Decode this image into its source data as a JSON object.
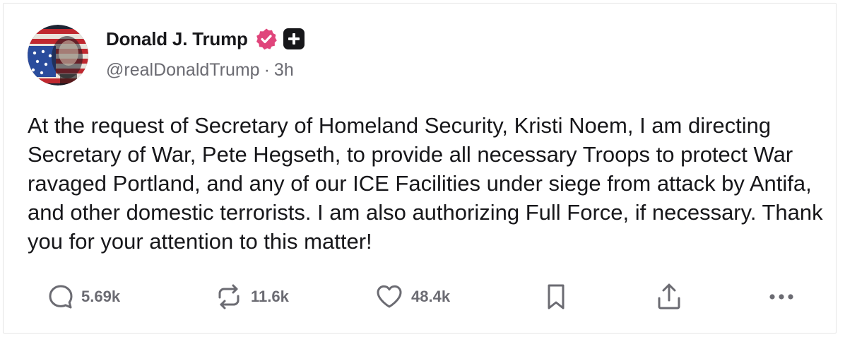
{
  "author": {
    "display_name": "Donald J. Trump",
    "handle": "@realDonaldTrump",
    "separator": "·",
    "time": "3h",
    "verified_icon": "verified-badge-icon",
    "plus_icon": "plus-badge-icon"
  },
  "post": {
    "text": "At the request of Secretary of Homeland Security, Kristi Noem, I am directing Secretary of War, Pete Hegseth, to provide all necessary Troops to protect War ravaged Portland, and any of our ICE Facilities under siege from attack by Antifa, and other domestic terrorists. I am also authorizing Full Force, if necessary. Thank you for your attention to this matter!"
  },
  "actions": {
    "replies": {
      "icon": "reply-icon",
      "count": "5.69k"
    },
    "reposts": {
      "icon": "repost-icon",
      "count": "11.6k"
    },
    "likes": {
      "icon": "heart-icon",
      "count": "48.4k"
    },
    "bookmark": {
      "icon": "bookmark-icon"
    },
    "share": {
      "icon": "share-icon"
    },
    "more": {
      "icon": "more-icon"
    }
  },
  "colors": {
    "text": "#17171a",
    "muted": "#6b6b72",
    "verified": "#e0457b",
    "plus_badge": "#17171a",
    "border": "#e6e6e6"
  }
}
